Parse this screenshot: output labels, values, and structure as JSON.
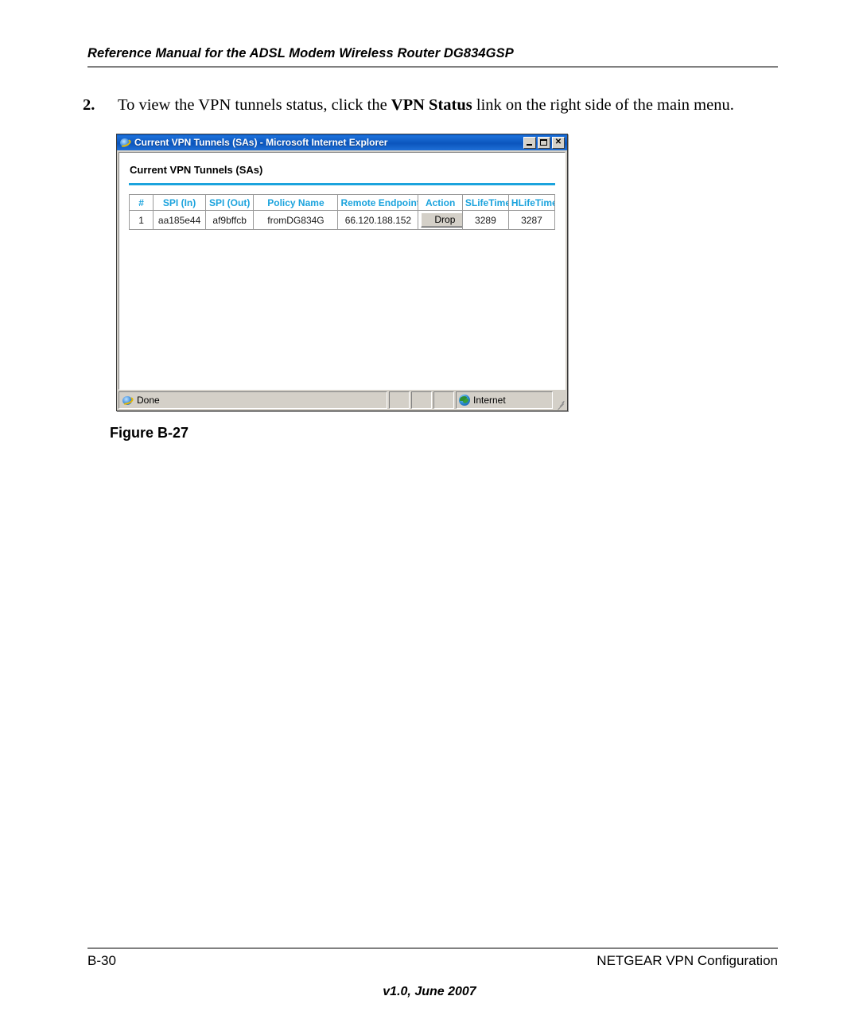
{
  "page": {
    "running_header": "Reference Manual for the ADSL Modem Wireless Router DG834GSP",
    "step_number": "2.",
    "step_text_before": "To view the VPN tunnels status, click the ",
    "step_text_bold": "VPN Status",
    "step_text_after": " link on the right side of the main menu.",
    "figure_caption": "Figure B-27"
  },
  "browser_window": {
    "title": "Current VPN Tunnels (SAs) - Microsoft Internet Explorer",
    "app_icon": "internet-explorer-icon",
    "buttons": {
      "minimize": "_",
      "maximize": "□",
      "close": "✕"
    },
    "status_bar": {
      "status_icon": "internet-explorer-icon",
      "status_text": "Done",
      "zone_icon": "globe-icon",
      "zone_text": "Internet"
    }
  },
  "panel": {
    "heading": "Current VPN Tunnels (SAs)",
    "accent_color": "#1ba3dd"
  },
  "table": {
    "columns": [
      "#",
      "SPI (In)",
      "SPI (Out)",
      "Policy Name",
      "Remote Endpoint",
      "Action",
      "SLifeTime",
      "HLifeTime"
    ],
    "rows": [
      {
        "num": "1",
        "spi_in": "aa185e44",
        "spi_out": "af9bffcb",
        "policy_name": "fromDG834G",
        "remote_endpoint": "66.120.188.152",
        "action_label": "Drop",
        "slifetime": "3289",
        "hlifetime": "3287"
      }
    ]
  },
  "footer": {
    "page_number": "B-30",
    "section": "NETGEAR VPN Configuration",
    "version": "v1.0, June 2007"
  }
}
